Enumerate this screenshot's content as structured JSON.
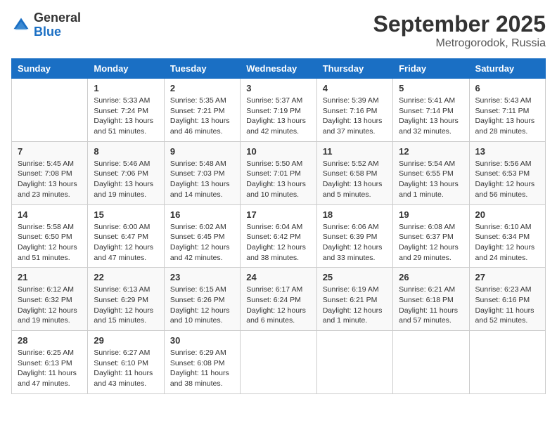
{
  "header": {
    "logo_general": "General",
    "logo_blue": "Blue",
    "month": "September 2025",
    "location": "Metrogorodok, Russia"
  },
  "weekdays": [
    "Sunday",
    "Monday",
    "Tuesday",
    "Wednesday",
    "Thursday",
    "Friday",
    "Saturday"
  ],
  "weeks": [
    [
      {
        "day": "",
        "info": ""
      },
      {
        "day": "1",
        "info": "Sunrise: 5:33 AM\nSunset: 7:24 PM\nDaylight: 13 hours\nand 51 minutes."
      },
      {
        "day": "2",
        "info": "Sunrise: 5:35 AM\nSunset: 7:21 PM\nDaylight: 13 hours\nand 46 minutes."
      },
      {
        "day": "3",
        "info": "Sunrise: 5:37 AM\nSunset: 7:19 PM\nDaylight: 13 hours\nand 42 minutes."
      },
      {
        "day": "4",
        "info": "Sunrise: 5:39 AM\nSunset: 7:16 PM\nDaylight: 13 hours\nand 37 minutes."
      },
      {
        "day": "5",
        "info": "Sunrise: 5:41 AM\nSunset: 7:14 PM\nDaylight: 13 hours\nand 32 minutes."
      },
      {
        "day": "6",
        "info": "Sunrise: 5:43 AM\nSunset: 7:11 PM\nDaylight: 13 hours\nand 28 minutes."
      }
    ],
    [
      {
        "day": "7",
        "info": "Sunrise: 5:45 AM\nSunset: 7:08 PM\nDaylight: 13 hours\nand 23 minutes."
      },
      {
        "day": "8",
        "info": "Sunrise: 5:46 AM\nSunset: 7:06 PM\nDaylight: 13 hours\nand 19 minutes."
      },
      {
        "day": "9",
        "info": "Sunrise: 5:48 AM\nSunset: 7:03 PM\nDaylight: 13 hours\nand 14 minutes."
      },
      {
        "day": "10",
        "info": "Sunrise: 5:50 AM\nSunset: 7:01 PM\nDaylight: 13 hours\nand 10 minutes."
      },
      {
        "day": "11",
        "info": "Sunrise: 5:52 AM\nSunset: 6:58 PM\nDaylight: 13 hours\nand 5 minutes."
      },
      {
        "day": "12",
        "info": "Sunrise: 5:54 AM\nSunset: 6:55 PM\nDaylight: 13 hours\nand 1 minute."
      },
      {
        "day": "13",
        "info": "Sunrise: 5:56 AM\nSunset: 6:53 PM\nDaylight: 12 hours\nand 56 minutes."
      }
    ],
    [
      {
        "day": "14",
        "info": "Sunrise: 5:58 AM\nSunset: 6:50 PM\nDaylight: 12 hours\nand 51 minutes."
      },
      {
        "day": "15",
        "info": "Sunrise: 6:00 AM\nSunset: 6:47 PM\nDaylight: 12 hours\nand 47 minutes."
      },
      {
        "day": "16",
        "info": "Sunrise: 6:02 AM\nSunset: 6:45 PM\nDaylight: 12 hours\nand 42 minutes."
      },
      {
        "day": "17",
        "info": "Sunrise: 6:04 AM\nSunset: 6:42 PM\nDaylight: 12 hours\nand 38 minutes."
      },
      {
        "day": "18",
        "info": "Sunrise: 6:06 AM\nSunset: 6:39 PM\nDaylight: 12 hours\nand 33 minutes."
      },
      {
        "day": "19",
        "info": "Sunrise: 6:08 AM\nSunset: 6:37 PM\nDaylight: 12 hours\nand 29 minutes."
      },
      {
        "day": "20",
        "info": "Sunrise: 6:10 AM\nSunset: 6:34 PM\nDaylight: 12 hours\nand 24 minutes."
      }
    ],
    [
      {
        "day": "21",
        "info": "Sunrise: 6:12 AM\nSunset: 6:32 PM\nDaylight: 12 hours\nand 19 minutes."
      },
      {
        "day": "22",
        "info": "Sunrise: 6:13 AM\nSunset: 6:29 PM\nDaylight: 12 hours\nand 15 minutes."
      },
      {
        "day": "23",
        "info": "Sunrise: 6:15 AM\nSunset: 6:26 PM\nDaylight: 12 hours\nand 10 minutes."
      },
      {
        "day": "24",
        "info": "Sunrise: 6:17 AM\nSunset: 6:24 PM\nDaylight: 12 hours\nand 6 minutes."
      },
      {
        "day": "25",
        "info": "Sunrise: 6:19 AM\nSunset: 6:21 PM\nDaylight: 12 hours\nand 1 minute."
      },
      {
        "day": "26",
        "info": "Sunrise: 6:21 AM\nSunset: 6:18 PM\nDaylight: 11 hours\nand 57 minutes."
      },
      {
        "day": "27",
        "info": "Sunrise: 6:23 AM\nSunset: 6:16 PM\nDaylight: 11 hours\nand 52 minutes."
      }
    ],
    [
      {
        "day": "28",
        "info": "Sunrise: 6:25 AM\nSunset: 6:13 PM\nDaylight: 11 hours\nand 47 minutes."
      },
      {
        "day": "29",
        "info": "Sunrise: 6:27 AM\nSunset: 6:10 PM\nDaylight: 11 hours\nand 43 minutes."
      },
      {
        "day": "30",
        "info": "Sunrise: 6:29 AM\nSunset: 6:08 PM\nDaylight: 11 hours\nand 38 minutes."
      },
      {
        "day": "",
        "info": ""
      },
      {
        "day": "",
        "info": ""
      },
      {
        "day": "",
        "info": ""
      },
      {
        "day": "",
        "info": ""
      }
    ]
  ]
}
